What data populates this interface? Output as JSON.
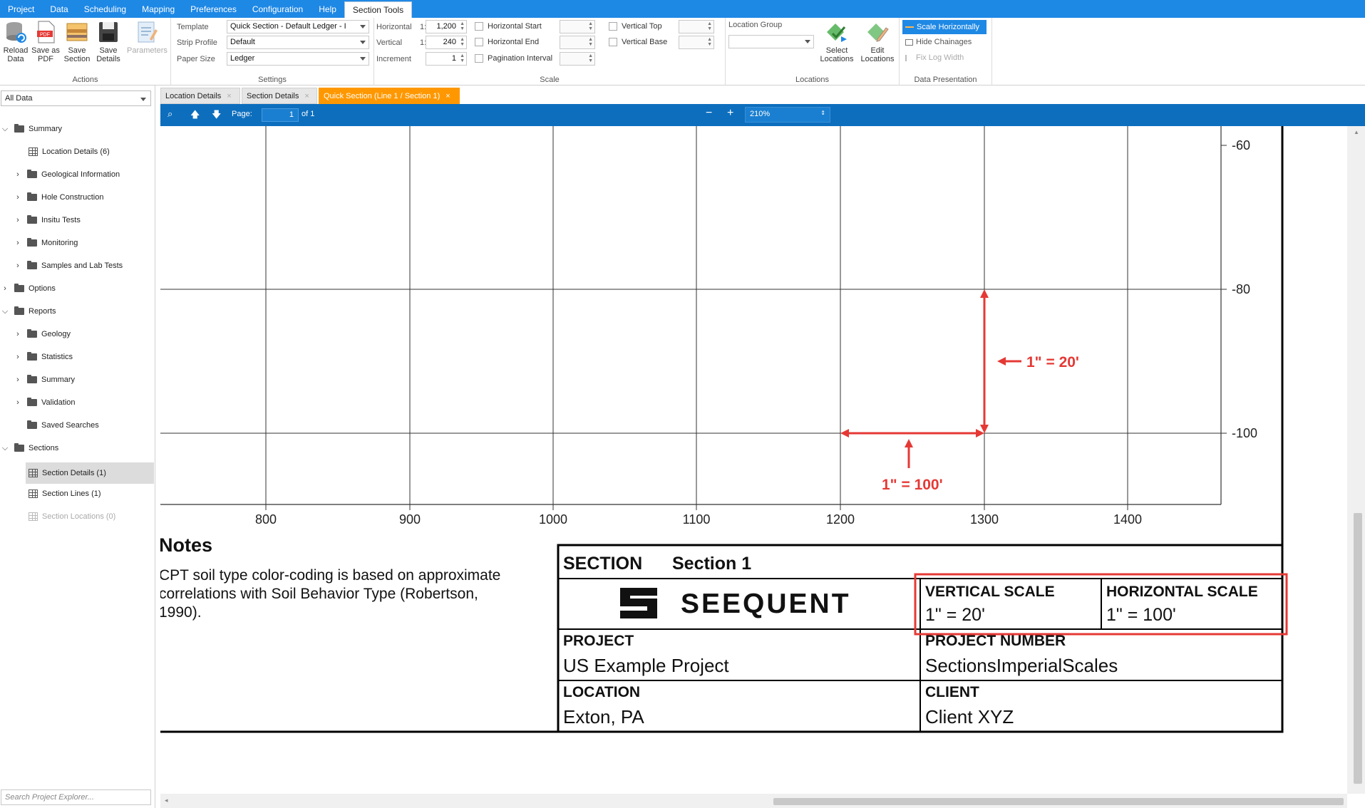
{
  "menu": {
    "items": [
      "Project",
      "Data",
      "Scheduling",
      "Mapping",
      "Preferences",
      "Configuration",
      "Help",
      "Section Tools"
    ]
  },
  "ribbon": {
    "actions": {
      "group_label": "Actions",
      "reload": "Reload Data",
      "save_pdf": "Save as PDF",
      "save_section": "Save Section",
      "save_details": "Save Details",
      "parameters": "Parameters"
    },
    "settings": {
      "group_label": "Settings",
      "template_label": "Template",
      "template_value": "Quick Section - Default Ledger - I",
      "strip_label": "Strip Profile",
      "strip_value": "Default",
      "paper_label": "Paper Size",
      "paper_value": "Ledger"
    },
    "scale": {
      "group_label": "Scale",
      "horizontal_label": "Horizontal",
      "horizontal_prefix": "1:",
      "horizontal_value": "1,200",
      "vertical_label": "Vertical",
      "vertical_prefix": "1:",
      "vertical_value": "240",
      "increment_label": "Increment",
      "increment_value": "1",
      "h_start": "Horizontal Start",
      "h_end": "Horizontal End",
      "pagination": "Pagination Interval",
      "v_top": "Vertical Top",
      "v_base": "Vertical Base"
    },
    "locations": {
      "group_label": "Locations",
      "location_group_label": "Location Group",
      "select": "Select Locations",
      "edit": "Edit Locations"
    },
    "presentation": {
      "group_label": "Data Presentation",
      "scale_h": "Scale Horizontally",
      "hide_chainages": "Hide Chainages",
      "fix_log": "Fix Log Width"
    }
  },
  "sidebar": {
    "filter": "All Data",
    "search_placeholder": "Search Project Explorer...",
    "tree": [
      "Summary",
      "Location Details (6)",
      "Geological Information",
      "Hole Construction",
      "Insitu Tests",
      "Monitoring",
      "Samples and Lab Tests",
      "Options",
      "Reports",
      "Geology",
      "Statistics",
      "Summary",
      "Validation",
      "Saved Searches",
      "Sections",
      "Section Details (1)",
      "Section Lines (1)",
      "Section Locations (0)"
    ]
  },
  "tabs": [
    "Location Details",
    "Section Details",
    "Quick Section (Line 1 / Section 1)"
  ],
  "viewer": {
    "page_label": "Page:",
    "page_value": "1",
    "page_of": "of 1",
    "zoom": "210%"
  },
  "section": {
    "y_ticks": [
      "-60",
      "-80",
      "-100"
    ],
    "x_ticks": [
      "800",
      "900",
      "1000",
      "1100",
      "1200",
      "1300",
      "1400"
    ],
    "annot_vertical": "1\" = 20'",
    "annot_horizontal": "1\" = 100'",
    "notes_title": "Notes",
    "notes_lines": [
      "CPT soil type color-coding is based on approximate",
      "correlations with Soil Behavior Type (Robertson,",
      "1990)."
    ],
    "title_block": {
      "section_label": "SECTION",
      "section_value": "Section 1",
      "logo_text": "SEEQUENT",
      "vscale_label": "VERTICAL SCALE",
      "vscale_value": "1\" = 20'",
      "hscale_label": "HORIZONTAL SCALE",
      "hscale_value": "1\" = 100'",
      "project_label": "PROJECT",
      "project_value": "US Example Project",
      "projnum_label": "PROJECT NUMBER",
      "projnum_value": "SectionsImperialScales",
      "location_label": "LOCATION",
      "location_value": "Exton, PA",
      "client_label": "CLIENT",
      "client_value": "Client XYZ"
    }
  },
  "colors": {
    "menubar": "#1e88e5",
    "viewer_toolbar": "#0d6ebd",
    "active_tab": "#ff9800",
    "annotation": "#e53935"
  }
}
